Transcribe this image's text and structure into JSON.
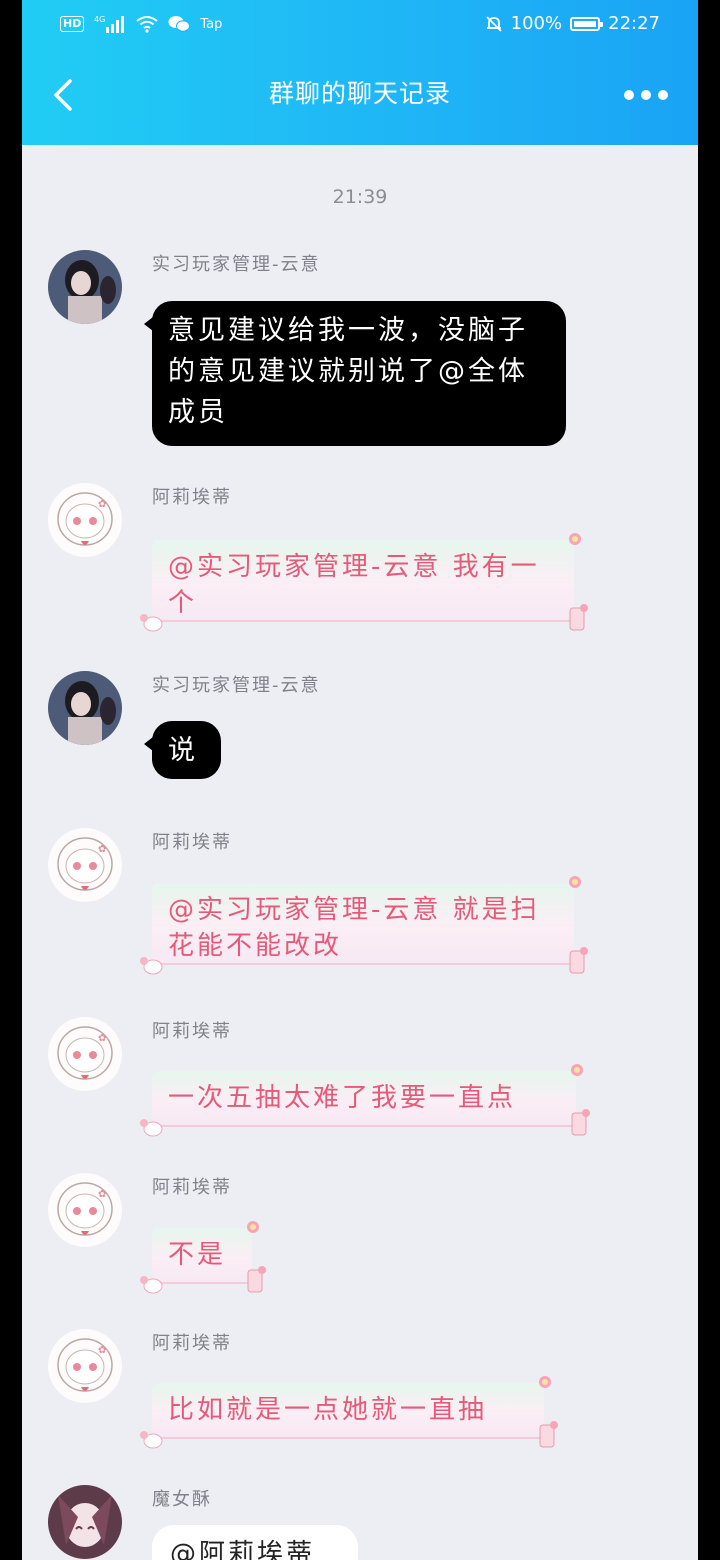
{
  "status_bar": {
    "left_icons": [
      "HD",
      "4G",
      "signal",
      "wifi",
      "wechat"
    ],
    "tap_label": "Tap",
    "battery_percent": "100%",
    "clock": "22:27"
  },
  "header": {
    "title": "群聊的聊天记录"
  },
  "timestamp": "21:39",
  "messages": [
    {
      "sender": "实习玩家管理-云意",
      "text": "意见建议给我一波，没脑子的意见建议就别说了@全体成员"
    },
    {
      "sender": "阿莉埃蒂",
      "text": "@实习玩家管理-云意 我有一个"
    },
    {
      "sender": "实习玩家管理-云意",
      "text": "说"
    },
    {
      "sender": "阿莉埃蒂",
      "text": "@实习玩家管理-云意 就是扫花能不能改改"
    },
    {
      "sender": "阿莉埃蒂",
      "text": "一次五抽太难了我要一直点"
    },
    {
      "sender": "阿莉埃蒂",
      "text": "不是"
    },
    {
      "sender": "阿莉埃蒂",
      "text": "比如就是一点她就一直抽"
    },
    {
      "sender": "魔女酥",
      "text": "@阿莉埃蒂"
    }
  ],
  "colors": {
    "header_start": "#21cdf4",
    "header_end": "#1aa3f5",
    "pink_text": "#e55a78",
    "background": "#eceef3"
  }
}
